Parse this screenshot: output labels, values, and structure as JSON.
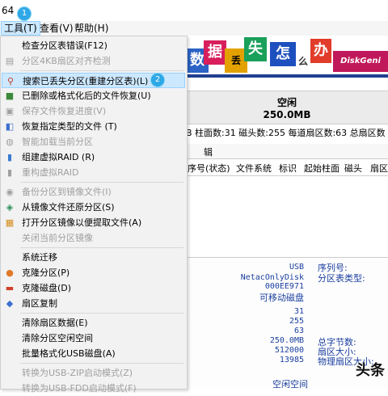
{
  "title_fragment": "64",
  "markers": {
    "menu": "1",
    "item": "2"
  },
  "menubar": {
    "items": [
      {
        "label": "工具(T)",
        "open": true
      },
      {
        "label": "查看(V)"
      },
      {
        "label": "帮助(H)"
      }
    ]
  },
  "banner": {
    "glyphs": [
      "数",
      "据",
      "丢",
      "失",
      "怎",
      "么",
      "办"
    ],
    "logo": "DiskGeni"
  },
  "space_box": {
    "label": "空闲",
    "size": "250.0MB"
  },
  "info_line": "B  柱面数:31  磁头数:255  每道扇区数:63  总扇区数",
  "tab_label": "辑",
  "columns": [
    "序号(状态)",
    "文件系统",
    "标识",
    "起始柱面",
    "磁头",
    "扇区"
  ],
  "details": {
    "values1": [
      "USB",
      "NetacOnlyDisk",
      "000EE971",
      "可移动磁盘"
    ],
    "labels1": [
      "序列号:",
      "分区表类型:"
    ],
    "values2": [
      "31",
      "255",
      "63",
      "250.0MB",
      "512000",
      "13985"
    ],
    "labels2": [
      "总字节数:",
      "扇区大小:",
      "物理扇区大小:"
    ],
    "free": "空闲空间"
  },
  "watermark": "头条",
  "dropdown": [
    {
      "label": "检查分区表错误(F12)",
      "icon": "none",
      "disabled": false
    },
    {
      "label": "分区4KB扇区对齐检测",
      "icon": "align-icon",
      "disabled": true
    },
    {
      "sep": true
    },
    {
      "label": "搜索已丢失分区(重建分区表)(L)",
      "icon": "magnifier-icon",
      "disabled": false,
      "highlight": true
    },
    {
      "label": "已删除或格式化后的文件恢复(U)",
      "icon": "recover-icon",
      "disabled": false
    },
    {
      "label": "保存文件恢复进度(V)",
      "icon": "save-icon",
      "disabled": true
    },
    {
      "label": "恢复指定类型的文件 (T)",
      "icon": "filetype-icon",
      "disabled": false
    },
    {
      "label": "智能加载当前分区",
      "icon": "smart-load-icon",
      "disabled": true
    },
    {
      "label": "组建虚拟RAID (R)",
      "icon": "raid-icon",
      "disabled": false
    },
    {
      "label": "重构虚拟RAID",
      "icon": "raid-rebuild-icon",
      "disabled": true
    },
    {
      "sep": true
    },
    {
      "label": "备份分区到镜像文件(I)",
      "icon": "backup-icon",
      "disabled": true
    },
    {
      "label": "从镜像文件还原分区(S)",
      "icon": "restore-icon",
      "disabled": false
    },
    {
      "label": "打开分区镜像以便提取文件(A)",
      "icon": "open-image-icon",
      "disabled": false
    },
    {
      "label": "关闭当前分区镜像",
      "icon": "none",
      "disabled": true
    },
    {
      "sep": true
    },
    {
      "label": "系统迁移",
      "icon": "none",
      "disabled": false
    },
    {
      "label": "克隆分区(P)",
      "icon": "clone-partition-icon",
      "disabled": false
    },
    {
      "label": "克隆磁盘(D)",
      "icon": "clone-disk-icon",
      "disabled": false
    },
    {
      "label": "扇区复制",
      "icon": "sector-copy-icon",
      "disabled": false
    },
    {
      "sep": true
    },
    {
      "label": "清除扇区数据(E)",
      "icon": "none",
      "disabled": false
    },
    {
      "label": "清除分区空闲空间",
      "icon": "none",
      "disabled": false
    },
    {
      "label": "批量格式化USB磁盘(A)",
      "icon": "none",
      "disabled": false
    },
    {
      "sep": true
    },
    {
      "label": "转换为USB-ZIP启动模式(Z)",
      "icon": "none",
      "disabled": true
    },
    {
      "label": "转换为USB-FDD启动模式(F)",
      "icon": "none",
      "disabled": true
    }
  ]
}
